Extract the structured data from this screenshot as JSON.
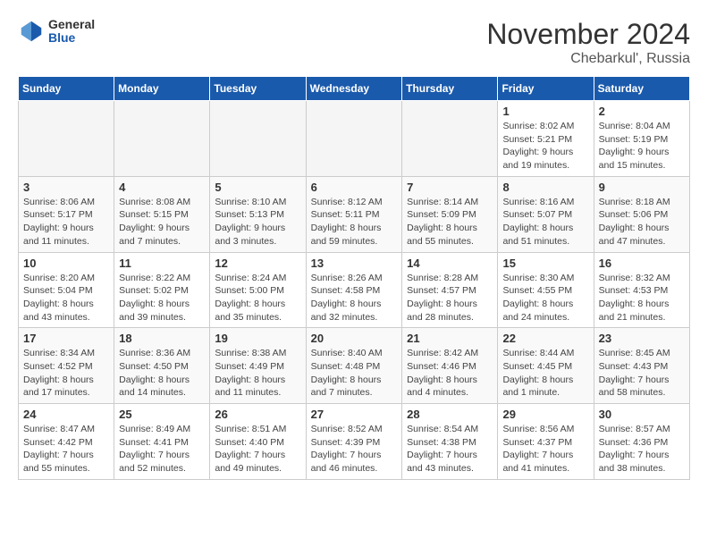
{
  "logo": {
    "general": "General",
    "blue": "Blue"
  },
  "title": "November 2024",
  "subtitle": "Chebarkul', Russia",
  "headers": [
    "Sunday",
    "Monday",
    "Tuesday",
    "Wednesday",
    "Thursday",
    "Friday",
    "Saturday"
  ],
  "weeks": [
    [
      {
        "day": "",
        "info": ""
      },
      {
        "day": "",
        "info": ""
      },
      {
        "day": "",
        "info": ""
      },
      {
        "day": "",
        "info": ""
      },
      {
        "day": "",
        "info": ""
      },
      {
        "day": "1",
        "info": "Sunrise: 8:02 AM\nSunset: 5:21 PM\nDaylight: 9 hours and 19 minutes."
      },
      {
        "day": "2",
        "info": "Sunrise: 8:04 AM\nSunset: 5:19 PM\nDaylight: 9 hours and 15 minutes."
      }
    ],
    [
      {
        "day": "3",
        "info": "Sunrise: 8:06 AM\nSunset: 5:17 PM\nDaylight: 9 hours and 11 minutes."
      },
      {
        "day": "4",
        "info": "Sunrise: 8:08 AM\nSunset: 5:15 PM\nDaylight: 9 hours and 7 minutes."
      },
      {
        "day": "5",
        "info": "Sunrise: 8:10 AM\nSunset: 5:13 PM\nDaylight: 9 hours and 3 minutes."
      },
      {
        "day": "6",
        "info": "Sunrise: 8:12 AM\nSunset: 5:11 PM\nDaylight: 8 hours and 59 minutes."
      },
      {
        "day": "7",
        "info": "Sunrise: 8:14 AM\nSunset: 5:09 PM\nDaylight: 8 hours and 55 minutes."
      },
      {
        "day": "8",
        "info": "Sunrise: 8:16 AM\nSunset: 5:07 PM\nDaylight: 8 hours and 51 minutes."
      },
      {
        "day": "9",
        "info": "Sunrise: 8:18 AM\nSunset: 5:06 PM\nDaylight: 8 hours and 47 minutes."
      }
    ],
    [
      {
        "day": "10",
        "info": "Sunrise: 8:20 AM\nSunset: 5:04 PM\nDaylight: 8 hours and 43 minutes."
      },
      {
        "day": "11",
        "info": "Sunrise: 8:22 AM\nSunset: 5:02 PM\nDaylight: 8 hours and 39 minutes."
      },
      {
        "day": "12",
        "info": "Sunrise: 8:24 AM\nSunset: 5:00 PM\nDaylight: 8 hours and 35 minutes."
      },
      {
        "day": "13",
        "info": "Sunrise: 8:26 AM\nSunset: 4:58 PM\nDaylight: 8 hours and 32 minutes."
      },
      {
        "day": "14",
        "info": "Sunrise: 8:28 AM\nSunset: 4:57 PM\nDaylight: 8 hours and 28 minutes."
      },
      {
        "day": "15",
        "info": "Sunrise: 8:30 AM\nSunset: 4:55 PM\nDaylight: 8 hours and 24 minutes."
      },
      {
        "day": "16",
        "info": "Sunrise: 8:32 AM\nSunset: 4:53 PM\nDaylight: 8 hours and 21 minutes."
      }
    ],
    [
      {
        "day": "17",
        "info": "Sunrise: 8:34 AM\nSunset: 4:52 PM\nDaylight: 8 hours and 17 minutes."
      },
      {
        "day": "18",
        "info": "Sunrise: 8:36 AM\nSunset: 4:50 PM\nDaylight: 8 hours and 14 minutes."
      },
      {
        "day": "19",
        "info": "Sunrise: 8:38 AM\nSunset: 4:49 PM\nDaylight: 8 hours and 11 minutes."
      },
      {
        "day": "20",
        "info": "Sunrise: 8:40 AM\nSunset: 4:48 PM\nDaylight: 8 hours and 7 minutes."
      },
      {
        "day": "21",
        "info": "Sunrise: 8:42 AM\nSunset: 4:46 PM\nDaylight: 8 hours and 4 minutes."
      },
      {
        "day": "22",
        "info": "Sunrise: 8:44 AM\nSunset: 4:45 PM\nDaylight: 8 hours and 1 minute."
      },
      {
        "day": "23",
        "info": "Sunrise: 8:45 AM\nSunset: 4:43 PM\nDaylight: 7 hours and 58 minutes."
      }
    ],
    [
      {
        "day": "24",
        "info": "Sunrise: 8:47 AM\nSunset: 4:42 PM\nDaylight: 7 hours and 55 minutes."
      },
      {
        "day": "25",
        "info": "Sunrise: 8:49 AM\nSunset: 4:41 PM\nDaylight: 7 hours and 52 minutes."
      },
      {
        "day": "26",
        "info": "Sunrise: 8:51 AM\nSunset: 4:40 PM\nDaylight: 7 hours and 49 minutes."
      },
      {
        "day": "27",
        "info": "Sunrise: 8:52 AM\nSunset: 4:39 PM\nDaylight: 7 hours and 46 minutes."
      },
      {
        "day": "28",
        "info": "Sunrise: 8:54 AM\nSunset: 4:38 PM\nDaylight: 7 hours and 43 minutes."
      },
      {
        "day": "29",
        "info": "Sunrise: 8:56 AM\nSunset: 4:37 PM\nDaylight: 7 hours and 41 minutes."
      },
      {
        "day": "30",
        "info": "Sunrise: 8:57 AM\nSunset: 4:36 PM\nDaylight: 7 hours and 38 minutes."
      }
    ]
  ]
}
